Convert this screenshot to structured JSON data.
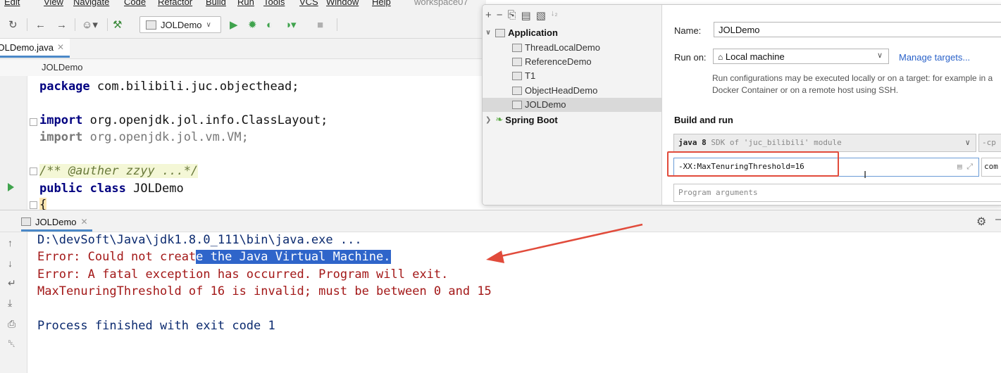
{
  "menubar": {
    "items": [
      "Edit",
      "View",
      "Navigate",
      "Code",
      "Refactor",
      "Build",
      "Run",
      "Tools",
      "VCS",
      "Window",
      "Help"
    ],
    "workspace": "workspace07"
  },
  "toolbar": {
    "run_config": "JOLDemo"
  },
  "editor": {
    "file_tab": "JOLDemo.java",
    "breadcrumb": "JOLDemo",
    "lines": {
      "l1_kw": "package",
      "l1_rest": " com.bilibili.juc.objecthead;",
      "l2_kw": "import",
      "l2_rest": " org.openjdk.jol.info.ClassLayout;",
      "l3_kw": "import",
      "l3_rest": " org.openjdk.jol.vm.VM;",
      "l4_doc": "/** @auther zzyy ...*/",
      "l5_kw1": "public",
      "l5_kw2": "class",
      "l5_rest": " JOLDemo",
      "l6_brace": "{"
    }
  },
  "run_dialog": {
    "tree": {
      "application": "Application",
      "items": [
        "ThreadLocalDemo",
        "ReferenceDemo",
        "T1",
        "ObjectHeadDemo",
        "JOLDemo"
      ],
      "spring_boot": "Spring Boot"
    },
    "name_label": "Name:",
    "name_value": "JOLDemo",
    "run_on_label": "Run on:",
    "run_on_value": "Local machine",
    "manage_targets": "Manage targets...",
    "description": "Run configurations may be executed locally or on a target: for example in a Docker Container or on a remote host using SSH.",
    "build_and_run": "Build and run",
    "jdk_bold": "java 8",
    "jdk_rest": " SDK of 'juc_bilibili' module",
    "cp_label": "-cp",
    "vm_options": "-XX:MaxTenuringThreshold=16",
    "main_class_partial": "com",
    "program_args_placeholder": "Program arguments",
    "highlight_color": "#e14b3b"
  },
  "run_panel": {
    "tab": "JOLDemo",
    "output": {
      "path": "D:\\devSoft\\Java\\jdk1.8.0_111\\bin\\java.exe ...",
      "err1_pre": "Error: Could not creat",
      "err1_sel": "e the Java Virtual Machine.",
      "err2": "Error: A fatal exception has occurred. Program will exit.",
      "err3": "MaxTenuringThreshold of 16 is invalid; must be between 0 and 15",
      "finished": "Process finished with exit code 1"
    },
    "arrow_color": "#e14b3b"
  }
}
